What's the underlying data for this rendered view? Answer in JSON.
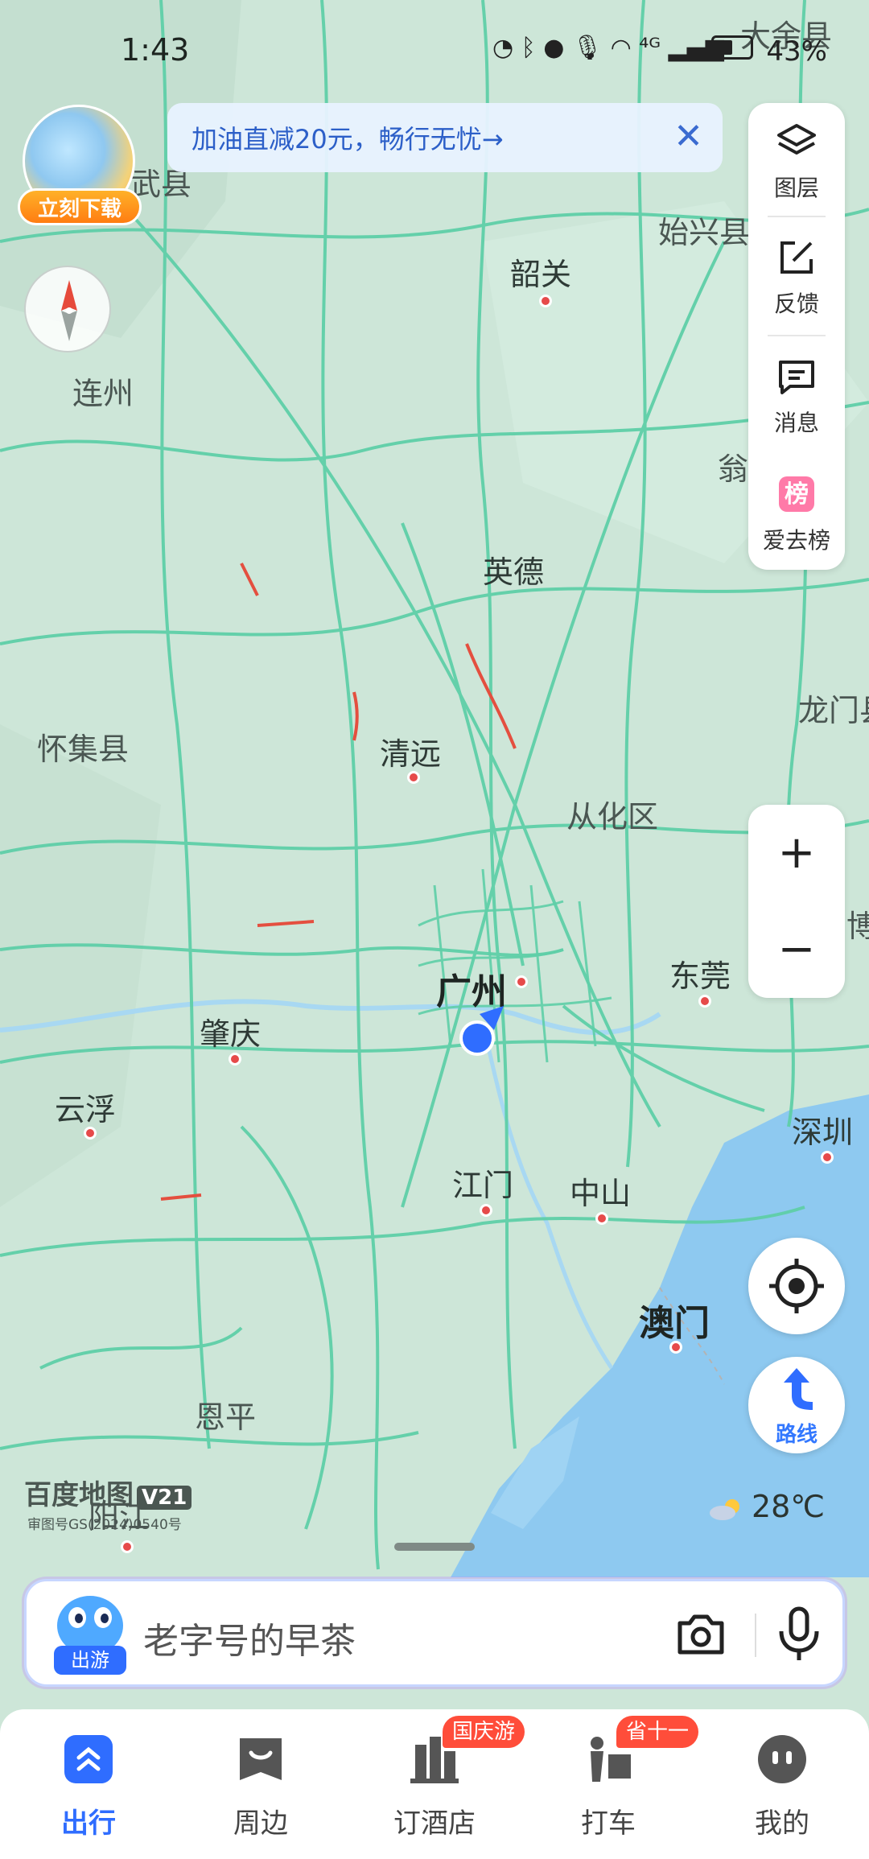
{
  "status_bar": {
    "time": "1:43",
    "battery": "43%",
    "icons_text": "◔ ᛒ ● 🎙 ◠ ⁴ᴳ ▂▄▆"
  },
  "promo_avatar": {
    "tag": "立刻下载"
  },
  "banner": {
    "text": "加油直减20元，畅行无忧→",
    "close": "✕"
  },
  "map": {
    "cities": [
      {
        "name": "大余县",
        "key": "dayu"
      },
      {
        "name": "武县",
        "key": "wuxian"
      },
      {
        "name": "始兴县",
        "key": "shixing"
      },
      {
        "name": "韶关",
        "key": "shaoguan"
      },
      {
        "name": "连州",
        "key": "lianzhou"
      },
      {
        "name": "翁",
        "key": "weng"
      },
      {
        "name": "英德",
        "key": "yingde"
      },
      {
        "name": "龙门县",
        "key": "longmen"
      },
      {
        "name": "怀集县",
        "key": "huaiji"
      },
      {
        "name": "清远",
        "key": "qingyuan"
      },
      {
        "name": "从化区",
        "key": "conghua"
      },
      {
        "name": "博",
        "key": "bo"
      },
      {
        "name": "广州",
        "key": "guangzhou"
      },
      {
        "name": "东莞",
        "key": "dongguan"
      },
      {
        "name": "肇庆",
        "key": "zhaoqing"
      },
      {
        "name": "云浮",
        "key": "yunfu"
      },
      {
        "name": "深圳",
        "key": "shenzhen"
      },
      {
        "name": "江门",
        "key": "jiangmen"
      },
      {
        "name": "中山",
        "key": "zhongshan"
      },
      {
        "name": "澳门",
        "key": "macau"
      },
      {
        "name": "恩平",
        "key": "enping"
      },
      {
        "name": "阳江",
        "key": "yangjiang"
      }
    ],
    "logo": "百度地图",
    "logo_version": "V21",
    "approval": "审图号GS(2024)0540号",
    "weather": "28℃"
  },
  "side_panel": {
    "items": [
      {
        "label": "图层",
        "icon": "layers-icon"
      },
      {
        "label": "反馈",
        "icon": "feedback-icon"
      },
      {
        "label": "消息",
        "icon": "message-icon"
      },
      {
        "label": "爱去榜",
        "icon": "ranking-icon"
      }
    ]
  },
  "zoom": {
    "in": "+",
    "out": "−"
  },
  "route": {
    "label": "路线"
  },
  "search": {
    "placeholder": "老字号的早茶",
    "avatar_tag": "出游"
  },
  "tabs": [
    {
      "label": "出行",
      "icon": "travel-icon",
      "active": true,
      "badge": ""
    },
    {
      "label": "周边",
      "icon": "nearby-icon",
      "active": false,
      "badge": ""
    },
    {
      "label": "订酒店",
      "icon": "hotel-icon",
      "active": false,
      "badge": "国庆游"
    },
    {
      "label": "打车",
      "icon": "taxi-icon",
      "active": false,
      "badge": "省十一"
    },
    {
      "label": "我的",
      "icon": "profile-icon",
      "active": false,
      "badge": ""
    }
  ],
  "colors": {
    "accent": "#2f6dff",
    "badge": "#ff4d3a",
    "sea": "#8ec9f0",
    "land": "#cde6d8",
    "road": "#5fcfa8"
  }
}
